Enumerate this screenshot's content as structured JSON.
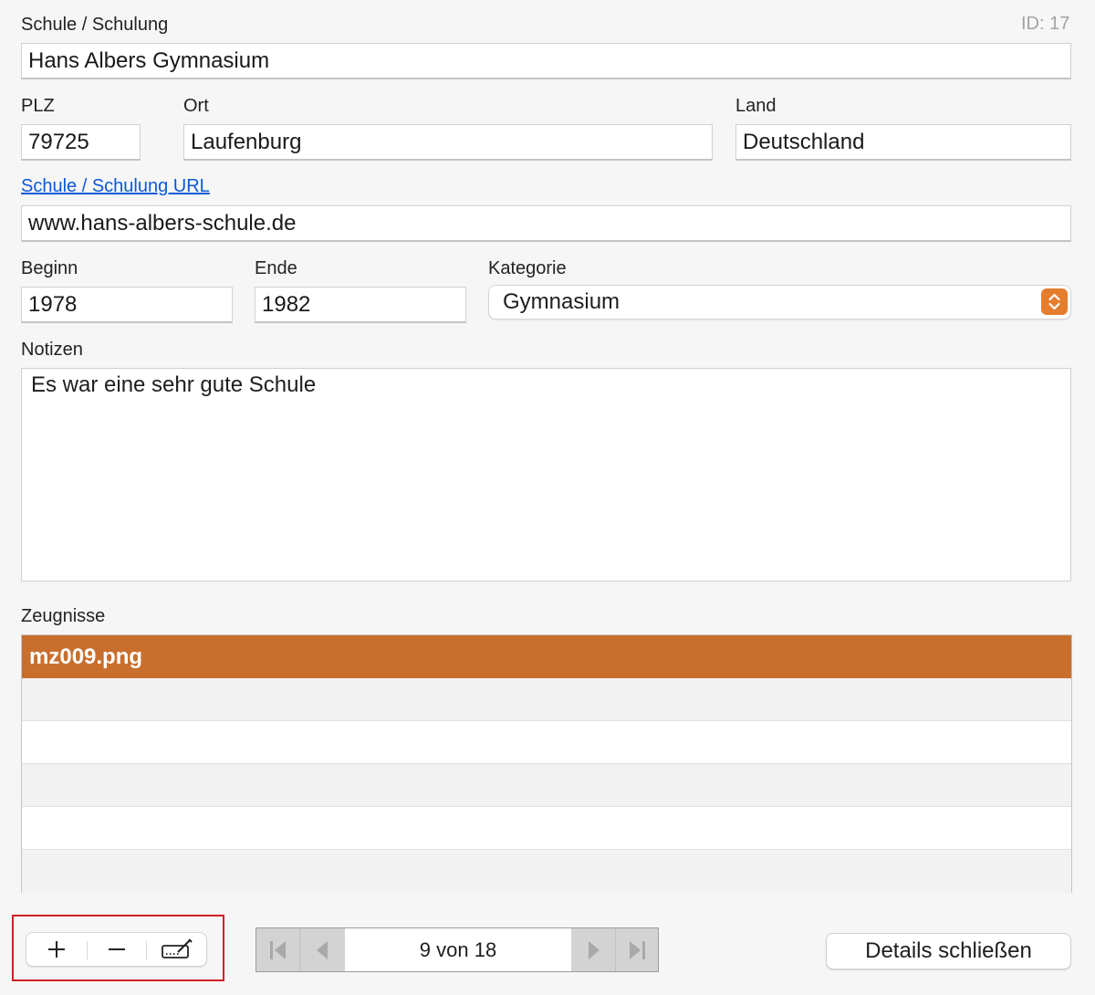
{
  "form": {
    "school_label": "Schule / Schulung",
    "id_label": "ID: 17",
    "school_value": "Hans Albers Gymnasium",
    "plz_label": "PLZ",
    "plz_value": "79725",
    "ort_label": "Ort",
    "ort_value": "Laufenburg",
    "land_label": "Land",
    "land_value": "Deutschland",
    "url_label": "Schule / Schulung URL",
    "url_value": "www.hans-albers-schule.de",
    "beginn_label": "Beginn",
    "beginn_value": "1978",
    "ende_label": "Ende",
    "ende_value": "1982",
    "kategorie_label": "Kategorie",
    "kategorie_value": "Gymnasium",
    "notes_label": "Notizen",
    "notes_value": "Es war eine sehr gute Schule"
  },
  "zeugnisse": {
    "label": "Zeugnisse",
    "rows": [
      "mz009.png",
      "",
      "",
      "",
      "",
      ""
    ]
  },
  "toolbar": {
    "add_icon": "plus-icon",
    "remove_icon": "minus-icon",
    "edit_icon": "edit-icon"
  },
  "nav": {
    "record_text": "9 von 18"
  },
  "buttons": {
    "close_details": "Details schließen"
  },
  "colors": {
    "accent": "#c96f2e",
    "link": "#0b5ad8",
    "highlight": "#d31f26"
  }
}
